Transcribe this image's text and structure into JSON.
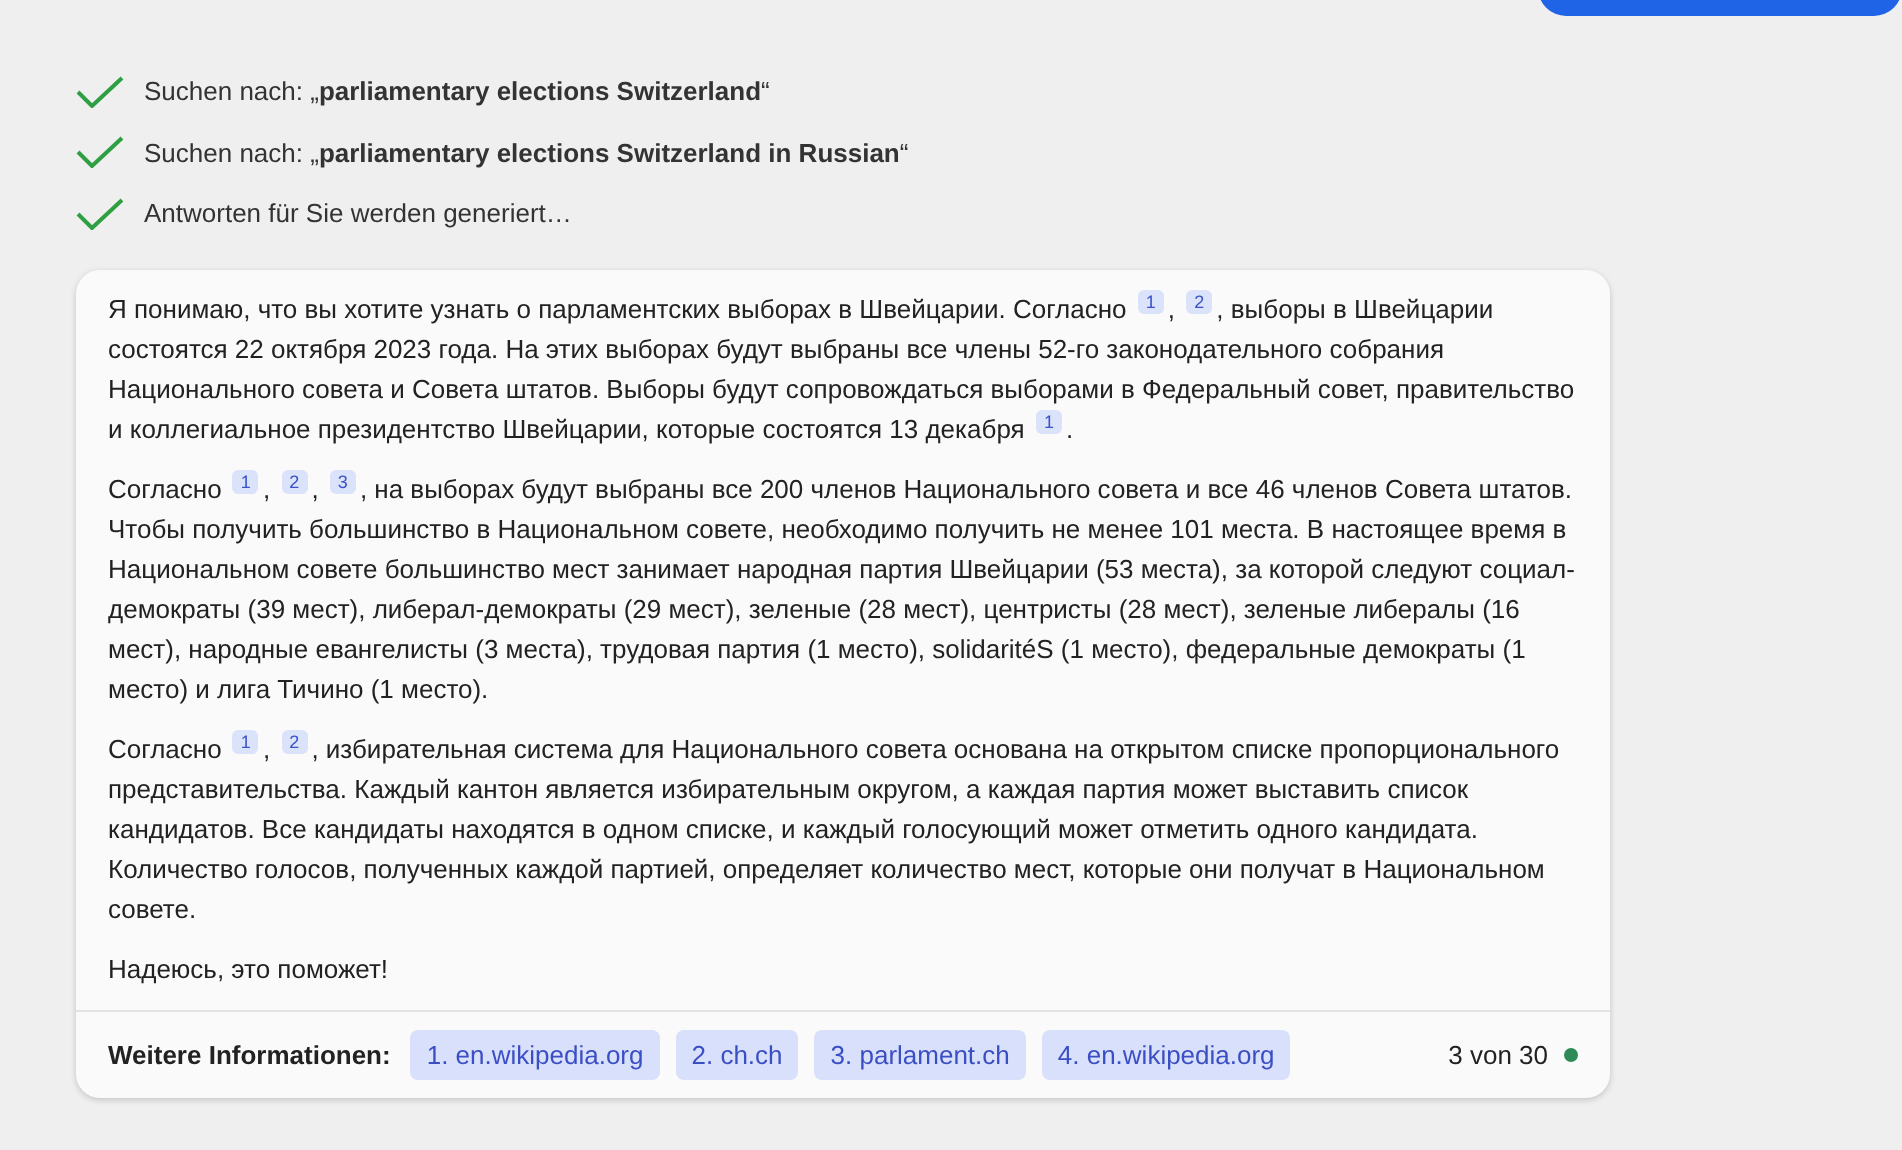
{
  "steps": [
    {
      "text": "Suchen nach: „**parliamentary elections Switzerland**“",
      "done": true
    },
    {
      "text": "Suchen nach: „**parliamentary elections Switzerland in Russian**“",
      "done": true
    },
    {
      "text": "Antworten für Sie werden generiert…",
      "done": true
    }
  ],
  "answer": {
    "paragraphs": [
      [
        {
          "kind": "text",
          "text": "Я понимаю, что вы хотите узнать о парламентских выборах в Швейцарии. Согласно "
        },
        {
          "kind": "cite",
          "text": "1"
        },
        {
          "kind": "text",
          "text": ", "
        },
        {
          "kind": "cite",
          "text": "2"
        },
        {
          "kind": "text",
          "text": ", выборы в Швейцарии состоятся 22 октября 2023 года. На этих выборах будут выбраны все члены 52-го законодательного собрания Национального совета и Совета штатов. Выборы будут сопровождаться выборами в Федеральный совет, правительство и коллегиальное президентство Швейцарии, которые состоятся 13 декабря "
        },
        {
          "kind": "cite",
          "text": "1"
        },
        {
          "kind": "text",
          "text": "."
        }
      ],
      [
        {
          "kind": "text",
          "text": "Согласно "
        },
        {
          "kind": "cite",
          "text": "1"
        },
        {
          "kind": "text",
          "text": ", "
        },
        {
          "kind": "cite",
          "text": "2"
        },
        {
          "kind": "text",
          "text": ", "
        },
        {
          "kind": "cite",
          "text": "3"
        },
        {
          "kind": "text",
          "text": ", на выборах будут выбраны все 200 членов Национального совета и все 46 членов Совета штатов. Чтобы получить большинство в Национальном совете, необходимо получить не менее 101 места. В настоящее время в Национальном совете большинство мест занимает народная партия Швейцарии (53 места), за которой следуют социал-демократы (39 мест), либерал-демократы (29 мест), зеленые (28 мест), центристы (28 мест), зеленые либералы (16 мест), народные евангелисты (3 места), трудовая партия (1 место), solidaritéS (1 место), федеральные демократы (1 место) и лига Тичино (1 место)."
        }
      ],
      [
        {
          "kind": "text",
          "text": "Согласно "
        },
        {
          "kind": "cite",
          "text": "1"
        },
        {
          "kind": "text",
          "text": ", "
        },
        {
          "kind": "cite",
          "text": "2"
        },
        {
          "kind": "text",
          "text": ", избирательная система для Национального совета основана на открытом списке пропорционального представительства. Каждый кантон является избирательным округом, а каждая партия может выставить список кандидатов. Все кандидаты находятся в одном списке, и каждый голосующий может отметить одного кандидата. Количество голосов, полученных каждой партией, определяет количество мест, которые они получат в Национальном совете."
        }
      ],
      [
        {
          "kind": "text",
          "text": "Надеюсь, это поможет!"
        }
      ]
    ],
    "footer": {
      "label": "Weitere Informationen:",
      "sources": [
        "1. en.wikipedia.org",
        "2. ch.ch",
        "3. parlament.ch",
        "4. en.wikipedia.org"
      ],
      "counter": "3 von 30",
      "status": {
        "color": "#2e8b57"
      }
    }
  }
}
